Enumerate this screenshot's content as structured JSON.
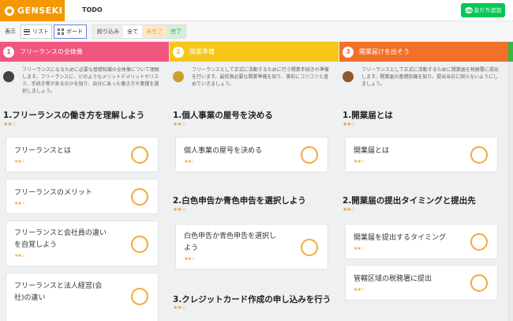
{
  "header": {
    "logo_text": "GENSEKI",
    "nav_todo": "TODO",
    "line_button_label": "友だち追加",
    "line_icon_text": "LINE",
    "colors": {
      "logo_bg": "#f39800",
      "line_green": "#06c755"
    }
  },
  "toolbar": {
    "view_label": "表示",
    "list_label": "リスト",
    "board_label": "ボード",
    "filter_label": "絞り込み",
    "filter_all": "全て",
    "filter_pending": "未完了",
    "filter_done": "完了",
    "selected_view": "ボード"
  },
  "columns": [
    {
      "number": "1",
      "title": "フリーランスの全体像",
      "color": "#f0577f",
      "description": "フリーランスになるために必要な基礎知識の全体像について理解します。フリーランスに、どのようなメリットデメリットやリスク、手続き等があるのかを知り、自分にあった働き方や業種を選択しましょう。",
      "sections": [
        {
          "title": "1.フリーランスの働き方を理解しよう",
          "stars": "★★☆",
          "cards": [
            {
              "title": "フリーランスとは",
              "stars": "★★☆"
            },
            {
              "title": "フリーランスのメリット",
              "stars": "★★☆"
            },
            {
              "title_line1": "フリーランスと会社員の違い",
              "title_line2": "を自覚しよう",
              "stars": "★★☆"
            },
            {
              "title_line1": "フリーランスと法人経営(会",
              "title_line2": "社)の違い"
            }
          ]
        }
      ]
    },
    {
      "number": "2",
      "title": "開業準備",
      "color": "#f7c61b",
      "description": "フリーランスとして正式に活動するために行う開業手続きの準備を行います。最低限必要な開業準備を知り、事前にコツコツと進めていきましょう。",
      "sections": [
        {
          "title": "1.個人事業の屋号を決める",
          "stars": "★★☆",
          "cards": [
            {
              "title": "個人事業の屋号を決める",
              "stars": "★★☆"
            }
          ]
        },
        {
          "title": "2.白色申告か青色申告を選択しよう",
          "stars": "★★☆",
          "cards": [
            {
              "title_line1": "白色申告か青色申告を選択し",
              "title_line2": "よう",
              "stars": "★★☆"
            }
          ]
        },
        {
          "title": "3.クレジットカード作成の申し込みを行う",
          "stars": "★★☆",
          "cards": []
        }
      ]
    },
    {
      "number": "3",
      "title": "開業届けを出そう",
      "color": "#f2702a",
      "description": "フリーランスとして正式に活動するために開業届を税務署に提出します。開業届の基礎知識を知り、提出当日に困らないようにしましょう。",
      "sections": [
        {
          "title": "1.開業届とは",
          "stars": "★★☆",
          "cards": [
            {
              "title": "開業届とは",
              "stars": "★★☆"
            }
          ]
        },
        {
          "title": "2.開業届の提出タイミングと提出先",
          "stars": "★★☆",
          "cards": [
            {
              "title": "開業届を提出するタイミング",
              "stars": "★★☆"
            },
            {
              "title": "管轄区域の税務署に提出",
              "stars": "★★☆"
            }
          ]
        }
      ]
    }
  ],
  "accent_colors": {
    "star": "#e8a23c",
    "check_circle": "#f3a93a",
    "board_active_border": "#6a7fdb"
  }
}
